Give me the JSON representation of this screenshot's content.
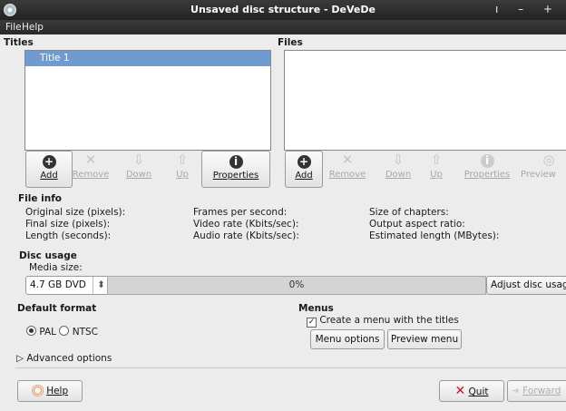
{
  "window": {
    "title": "Unsaved disc structure - DeVeDe",
    "controls": "ı – +"
  },
  "menu": {
    "file": "File",
    "help": "Help"
  },
  "titles": {
    "header": "Titles",
    "items": [
      "Title 1"
    ],
    "buttons": {
      "add": "Add",
      "remove": "Remove",
      "down": "Down",
      "up": "Up",
      "properties": "Properties"
    }
  },
  "files": {
    "header": "Files",
    "buttons": {
      "add": "Add",
      "remove": "Remove",
      "down": "Down",
      "up": "Up",
      "properties": "Properties",
      "preview": "Preview"
    }
  },
  "file_info": {
    "header": "File info",
    "original_size": "Original size (pixels):",
    "final_size": "Final size (pixels):",
    "length": "Length (seconds):",
    "fps": "Frames per second:",
    "video_rate": "Video rate (Kbits/sec):",
    "audio_rate": "Audio rate (Kbits/sec):",
    "chapters": "Size of chapters:",
    "aspect": "Output aspect ratio:",
    "est_length": "Estimated length (MBytes):"
  },
  "disc_usage": {
    "header": "Disc usage",
    "media_label": "Media size:",
    "media_value": "4.7 GB DVD",
    "progress_text": "0%",
    "progress_fraction": 0,
    "adjust_button": "Adjust disc usage"
  },
  "default_format": {
    "header": "Default format",
    "pal": "PAL",
    "ntsc": "NTSC",
    "selected": "PAL"
  },
  "menus": {
    "header": "Menus",
    "create_menu": "Create a menu with the titles",
    "create_menu_checked": true,
    "menu_options": "Menu options",
    "preview_menu": "Preview menu"
  },
  "advanced": {
    "label": "Advanced options"
  },
  "footer": {
    "help": "Help",
    "quit": "Quit",
    "forward": "Forward"
  }
}
